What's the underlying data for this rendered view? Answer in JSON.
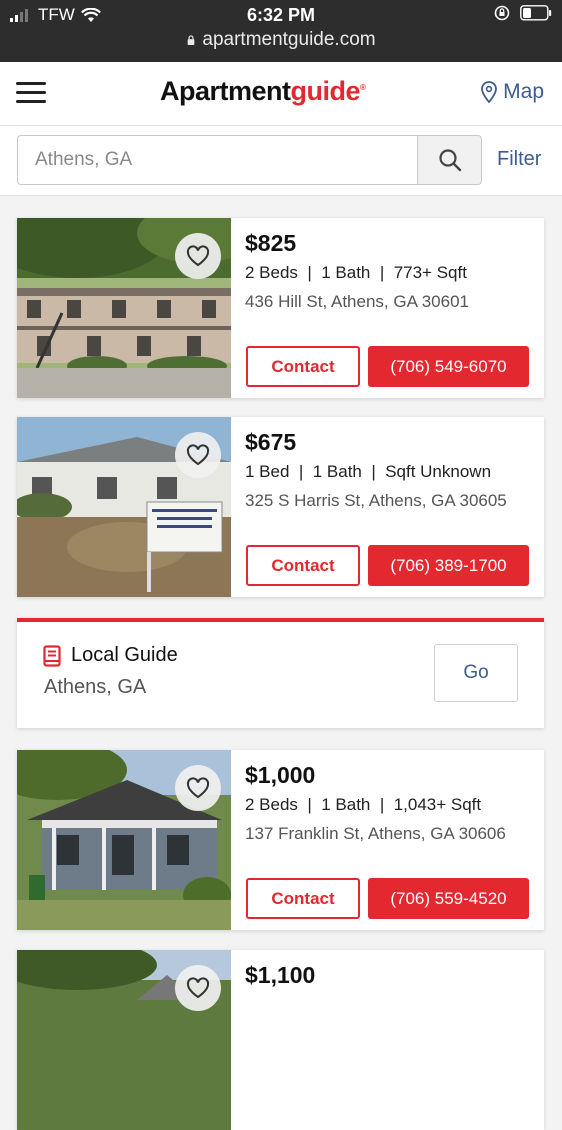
{
  "status_bar": {
    "carrier": "TFW",
    "time": "6:32 PM",
    "url": "apartmentguide.com"
  },
  "header": {
    "logo_main": "Apartment",
    "logo_accent": "guide",
    "map_label": "Map"
  },
  "search": {
    "placeholder": "Athens, GA",
    "filter_label": "Filter"
  },
  "listings": [
    {
      "price": "$825",
      "specs": "2 Beds  |  1 Bath  |  773+ Sqft",
      "address": "436 Hill St, Athens, GA 30601",
      "contact_label": "Contact",
      "phone": "(706) 549-6070"
    },
    {
      "price": "$675",
      "specs": "1 Bed  |  1 Bath  |  Sqft Unknown",
      "address": "325 S Harris St, Athens, GA 30605",
      "contact_label": "Contact",
      "phone": "(706) 389-1700"
    },
    {
      "price": "$1,000",
      "specs": "2 Beds  |  1 Bath  |  1,043+ Sqft",
      "address": "137 Franklin St, Athens, GA 30606",
      "contact_label": "Contact",
      "phone": "(706) 559-4520"
    },
    {
      "price": "$1,100"
    }
  ],
  "local_guide": {
    "title": "Local Guide",
    "subtitle": "Athens, GA",
    "go_label": "Go"
  },
  "colors": {
    "brand_red": "#e3282f",
    "link_blue": "#3b5d8f"
  }
}
